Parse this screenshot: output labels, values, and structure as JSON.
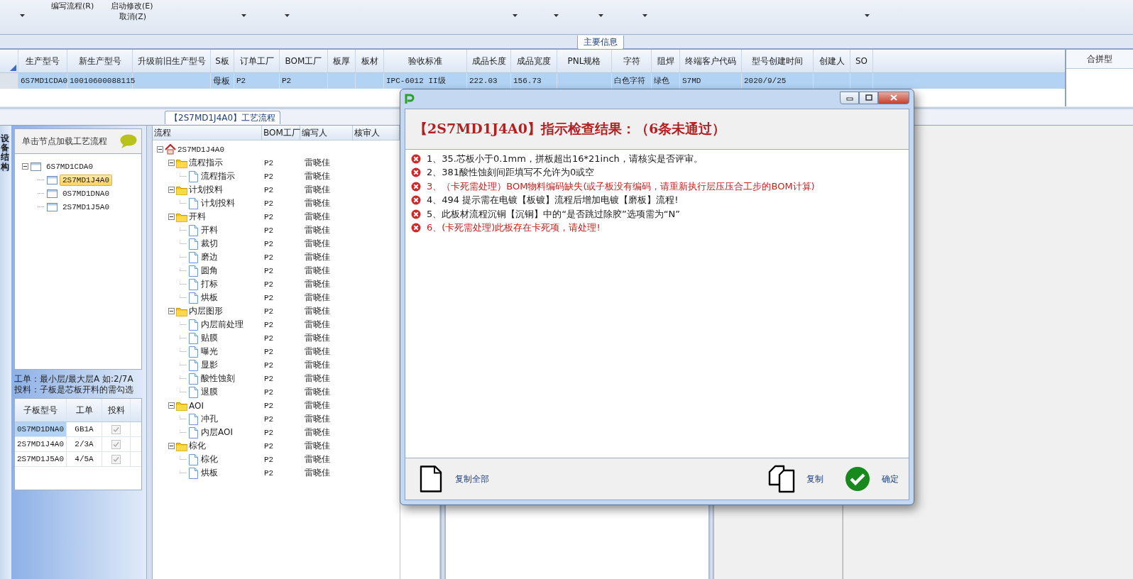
{
  "ribbon": {
    "menu_items": [
      {
        "label": "编写流程(R)"
      },
      {
        "label": "启动修改(E)"
      },
      {
        "label": "取消(Z)"
      }
    ]
  },
  "tabs": [
    {
      "label": "主要信息",
      "selected": true
    }
  ],
  "main_grid": {
    "columns": [
      "生产型号",
      "新生产型号",
      "升级前旧生产型号",
      "S板",
      "订单工厂",
      "BOM工厂",
      "板厚",
      "板材",
      "验收标准",
      "成品长度",
      "成品宽度",
      "PNL规格",
      "字符",
      "阻焊",
      "终端客户代码",
      "型号创建时间",
      "创建人",
      "SO"
    ],
    "rows": [
      {
        "selected": true,
        "cells": [
          "6S7MD1CDA0",
          "10010600088115",
          null,
          "母板",
          "P2",
          "P2",
          null,
          null,
          "IPC-6012 II级",
          "222.03",
          "156.73",
          null,
          "白色字符",
          "绿色",
          "S7MD",
          "2020/9/25",
          null,
          null
        ]
      }
    ],
    "side_column": "合拼型"
  },
  "structure_panel": {
    "side_tab": "设备结构",
    "hint": "单击节点加载工艺流程",
    "tree": [
      {
        "label": "6S7MD1CDA0",
        "selected": false,
        "expanded": true,
        "children": [
          {
            "label": "2S7MD1J4A0",
            "selected": true
          },
          {
            "label": "0S7MD1DNA0",
            "selected": false
          },
          {
            "label": "2S7MD1J5A0",
            "selected": false
          }
        ]
      }
    ],
    "notes": [
      "工单：最小层/最大层A 如:2/7A",
      "投料：子板是芯板开料的需勾选"
    ],
    "sub_table": {
      "columns": [
        "子板型号",
        "工单",
        "投料"
      ],
      "rows": [
        {
          "model": "0S7MD1DNA0",
          "order": "GB1A",
          "checked": true,
          "disabled": true,
          "selected": true
        },
        {
          "model": "2S7MD1J4A0",
          "order": "2/3A",
          "checked": true,
          "disabled": true,
          "selected": false
        },
        {
          "model": "2S7MD1J5A0",
          "order": "4/5A",
          "checked": true,
          "disabled": true,
          "selected": false
        }
      ]
    }
  },
  "flow": {
    "title": "【2S7MD1J4A0】工艺流程",
    "columns": [
      "流程",
      "BOM工厂",
      "编写人",
      "核审人"
    ],
    "tree": [
      {
        "label": "2S7MD1J4A0",
        "kind": "root",
        "expanded": true,
        "children": [
          {
            "label": "流程指示",
            "kind": "folder",
            "expanded": true,
            "bom": "P2",
            "writer": "雷晓佳",
            "children": [
              {
                "label": "流程指示",
                "kind": "step",
                "bom": "P2",
                "writer": "雷晓佳"
              }
            ]
          },
          {
            "label": "计划投料",
            "kind": "folder",
            "expanded": true,
            "bom": "P2",
            "writer": "雷晓佳",
            "children": [
              {
                "label": "计划投料",
                "kind": "step",
                "bom": "P2",
                "writer": "雷晓佳"
              }
            ]
          },
          {
            "label": "开料",
            "kind": "folder",
            "expanded": true,
            "bom": "P2",
            "writer": "雷晓佳",
            "children": [
              {
                "label": "开料",
                "kind": "step",
                "bom": "P2",
                "writer": "雷晓佳"
              },
              {
                "label": "裁切",
                "kind": "step",
                "bom": "P2",
                "writer": "雷晓佳"
              },
              {
                "label": "磨边",
                "kind": "step",
                "bom": "P2",
                "writer": "雷晓佳"
              },
              {
                "label": "圆角",
                "kind": "step",
                "bom": "P2",
                "writer": "雷晓佳"
              },
              {
                "label": "打标",
                "kind": "step",
                "bom": "P2",
                "writer": "雷晓佳"
              },
              {
                "label": "烘板",
                "kind": "step",
                "bom": "P2",
                "writer": "雷晓佳"
              }
            ]
          },
          {
            "label": "内层图形",
            "kind": "folder",
            "expanded": true,
            "bom": "P2",
            "writer": "雷晓佳",
            "children": [
              {
                "label": "内层前处理",
                "kind": "step",
                "bom": "P2",
                "writer": "雷晓佳"
              },
              {
                "label": "贴膜",
                "kind": "step",
                "bom": "P2",
                "writer": "雷晓佳"
              },
              {
                "label": "曝光",
                "kind": "step",
                "bom": "P2",
                "writer": "雷晓佳"
              },
              {
                "label": "显影",
                "kind": "step",
                "bom": "P2",
                "writer": "雷晓佳"
              },
              {
                "label": "酸性蚀刻",
                "kind": "step",
                "bom": "P2",
                "writer": "雷晓佳"
              },
              {
                "label": "退膜",
                "kind": "step",
                "bom": "P2",
                "writer": "雷晓佳"
              }
            ]
          },
          {
            "label": "AOI",
            "kind": "folder",
            "expanded": true,
            "bom": "P2",
            "writer": "雷晓佳",
            "children": [
              {
                "label": "冲孔",
                "kind": "step",
                "bom": "P2",
                "writer": "雷晓佳"
              },
              {
                "label": "内层AOI",
                "kind": "step",
                "bom": "P2",
                "writer": "雷晓佳"
              }
            ]
          },
          {
            "label": "棕化",
            "kind": "folder",
            "expanded": true,
            "bom": "P2",
            "writer": "雷晓佳",
            "children": [
              {
                "label": "棕化",
                "kind": "step",
                "bom": "P2",
                "writer": "雷晓佳"
              },
              {
                "label": "烘板",
                "kind": "step",
                "bom": "P2",
                "writer": "雷晓佳"
              }
            ]
          }
        ]
      }
    ]
  },
  "dialog": {
    "title": "【2S7MD1J4A0】指示检查结果：（6条未通过）",
    "messages": [
      {
        "text": "1、35.芯板小于0.1mm，拼板超出16*21inch，请核实是否评审。",
        "color": "#1a1a1a"
      },
      {
        "text": "2、381酸性蚀刻间距填写不允许为0或空",
        "color": "#1a1a1a"
      },
      {
        "text": "3、（卡死需处理）BOM物料编码缺失(或子板没有编码，请重新执行层压压合工步的BOM计算)",
        "color": "#c8201e"
      },
      {
        "text": "4、494 提示需在电镀【板镀】流程后增加电镀【磨板】流程!",
        "color": "#1a1a1a"
      },
      {
        "text": "5、此板材流程沉铜【沉铜】中的“是否跳过除胶”选项需为“N”",
        "color": "#1a1a1a"
      },
      {
        "text": "6、(卡死需处理)此板存在卡死项，请处理!",
        "color": "#c8201e"
      }
    ],
    "buttons": [
      {
        "label": "复制全部",
        "kind": "copy-all"
      },
      {
        "label": "复制",
        "kind": "copy"
      },
      {
        "label": "确定",
        "kind": "ok"
      }
    ]
  }
}
